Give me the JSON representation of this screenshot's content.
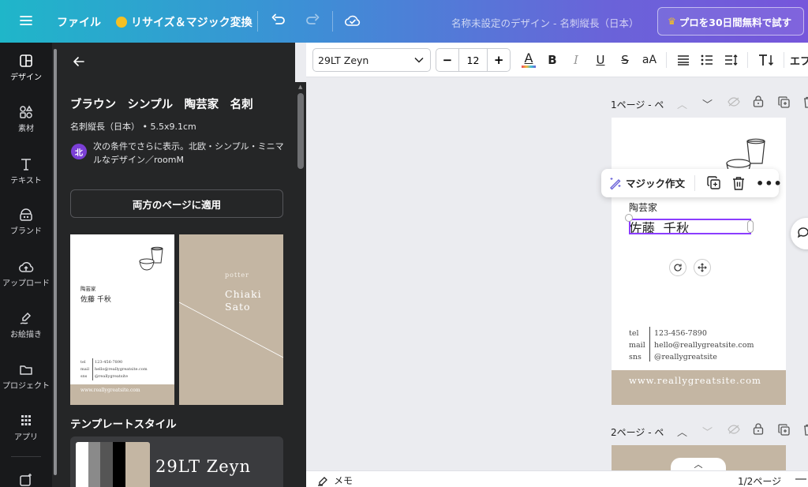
{
  "topbar": {
    "menu_icon": "hamburger-menu-icon",
    "file_label": "ファイル",
    "resize_label": "リサイズ＆マジック変換",
    "doc_title": "名称未設定のデザイン - 名刺縦長（日本）",
    "pro_button_label": "プロを30日間無料で試す"
  },
  "rail": {
    "items": [
      {
        "label": "デザイン",
        "icon": "design-icon"
      },
      {
        "label": "素材",
        "icon": "elements-icon"
      },
      {
        "label": "テキスト",
        "icon": "text-icon"
      },
      {
        "label": "ブランド",
        "icon": "brand-icon"
      },
      {
        "label": "アップロード",
        "icon": "upload-icon"
      },
      {
        "label": "お絵描き",
        "icon": "draw-icon"
      },
      {
        "label": "プロジェクト",
        "icon": "folder-icon"
      },
      {
        "label": "アプリ",
        "icon": "apps-grid-icon"
      }
    ]
  },
  "panel": {
    "template_title": "ブラウン　シンプル　陶芸家　名刺",
    "template_meta": "名刺縦長（日本） • 5.5x9.1cm",
    "author_badge": "北",
    "author_line1": "次の条件でさらに表示。北欧・シンプル・ミニマ",
    "author_line2": "ルなデザイン／roomM",
    "apply_button": "両方のページに適用",
    "style_heading": "テンプレートスタイル",
    "style_font_name": "29LT Zeyn",
    "style_swatches": [
      "#ffffff",
      "#8a8a8a",
      "#555555",
      "#000000",
      "#c4b6a3"
    ]
  },
  "thumb_front": {
    "role": "陶芸家",
    "name": "佐藤 千秋",
    "tel_label": "tel",
    "tel": "123-456-7890",
    "mail_label": "mail",
    "mail": "hello@reallygreatsite.com",
    "sns_label": "sns",
    "sns": "@reallygreatsite",
    "website": "www.reallygreatsite.com"
  },
  "thumb_back": {
    "potter": "potter",
    "name_line1": "Chiaki",
    "name_line2": "Sato"
  },
  "toolbar": {
    "font_name": "29LT Zeyn",
    "font_size": "12",
    "minus": "−",
    "plus": "+",
    "text_color_letter": "A",
    "bold": "B",
    "italic": "I",
    "underline": "U",
    "strike": "S",
    "case": "aA",
    "overflow_label": "エフ",
    "text_color_bar": "#e8a13a"
  },
  "canvas": {
    "page1_label": "1ページ - ペ",
    "page2_label": "2ページ - ペ",
    "magic_write_label": "マジック作文",
    "card": {
      "role": "陶芸家",
      "name": "佐藤  千秋",
      "tel_label": "tel",
      "tel": "123-456-7890",
      "mail_label": "mail",
      "mail": "hello@reallygreatsite.com",
      "sns_label": "sns",
      "sns": "@reallygreatsite",
      "website": "www.reallygreatsite.com",
      "band_color": "#c4b6a3"
    }
  },
  "bottombar": {
    "notes_label": "メモ",
    "page_indicator": "1/2ページ"
  }
}
